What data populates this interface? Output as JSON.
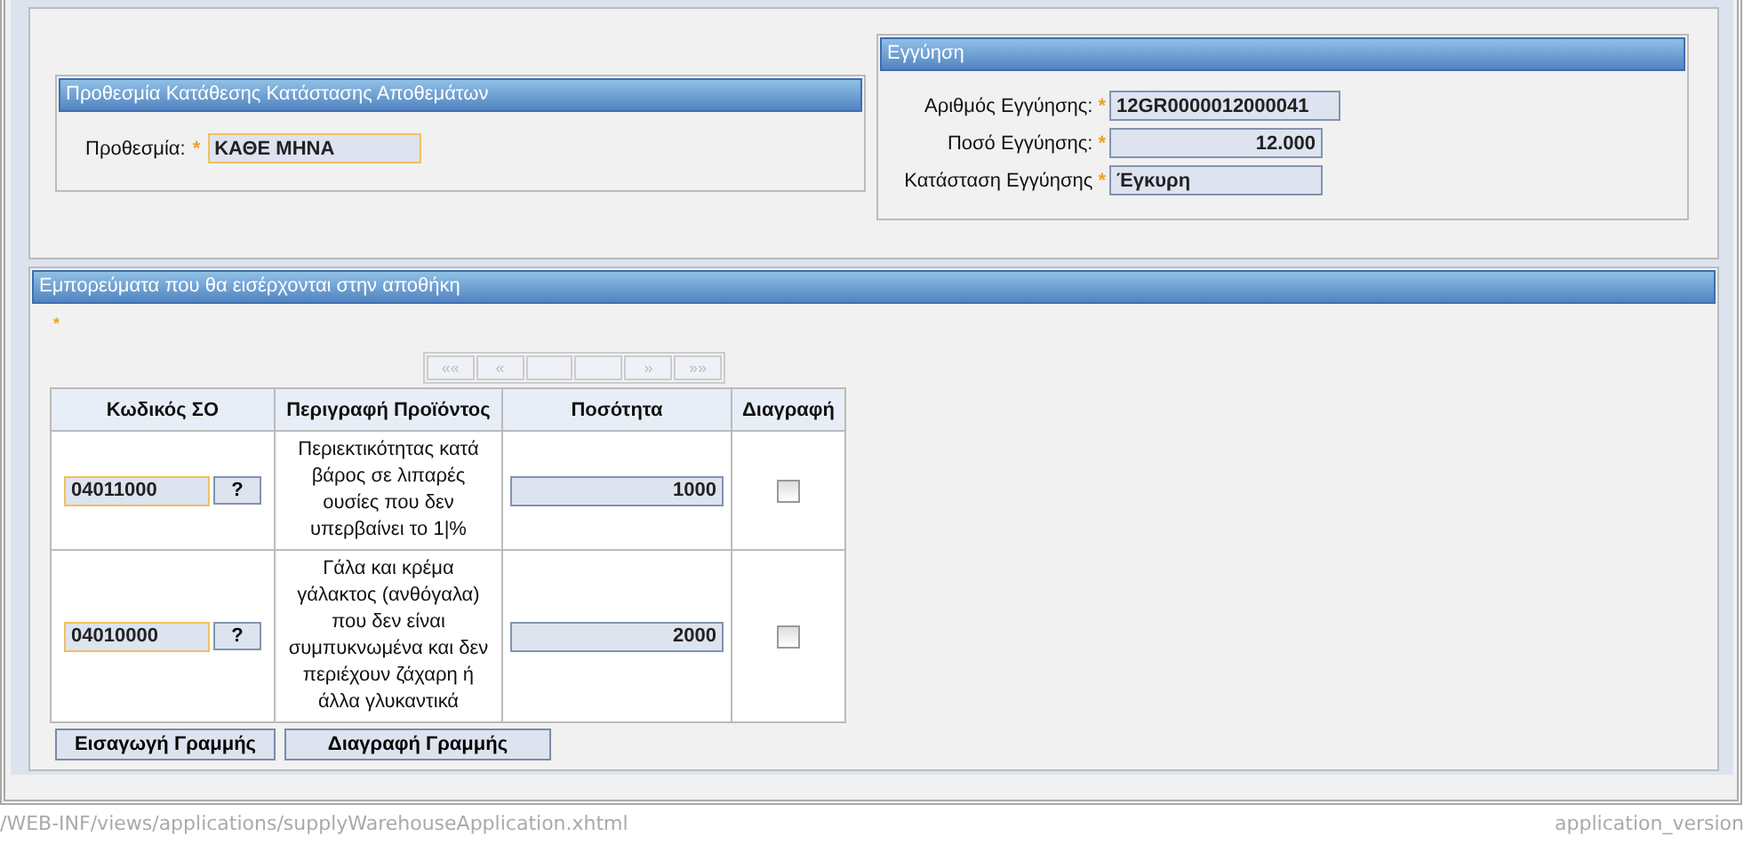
{
  "deadline_section": {
    "title": "Προθεσμία Κατάθεσης Κατάστασης Αποθεμάτων",
    "fields": [
      {
        "label": "Προθεσμία:",
        "mark": "*",
        "value": "ΚΑΘΕ ΜΗΝΑ",
        "highlighted": true
      }
    ]
  },
  "guarantee_section": {
    "title": "Εγγύηση",
    "fields": [
      {
        "label": "Αριθμός Εγγύησης:",
        "mark": "*",
        "value": "12GR0000012000041",
        "highlighted": false,
        "kind": "text"
      },
      {
        "label": "Ποσό Εγγύησης:",
        "mark": "*",
        "value": "12.000",
        "highlighted": false,
        "kind": "amount"
      },
      {
        "label": "Κατάσταση Εγγύησης",
        "mark": "*",
        "value": "Έγκυρη",
        "highlighted": false,
        "kind": "text"
      }
    ]
  },
  "goods_section": {
    "title": "Εμπορεύματα που θα εισέρχονται στην αποθήκη",
    "note_mark": "*",
    "paginator": [
      {
        "label": "««",
        "disabled": true
      },
      {
        "label": "«",
        "disabled": true
      },
      {
        "disabled": true
      },
      {
        "disabled": true
      },
      {
        "label": "»",
        "disabled": true
      },
      {
        "label": "»»",
        "disabled": true
      }
    ],
    "table": {
      "columns": [
        "Κωδικός ΣΟ",
        "Περιγραφή Προϊόντος",
        "Ποσότητα",
        "Διαγραφή"
      ],
      "rows": [
        {
          "code": "04011000",
          "code_highlighted": true,
          "lookup": "?",
          "description": "Περιεκτικότητας κατά βάρος σε λιπαρές ουσίες που δεν υπερβαίνει το 1|%",
          "quantity": "1000",
          "checked": false
        },
        {
          "code": "04010000",
          "code_highlighted": true,
          "lookup": "?",
          "description": "Γάλα και κρέμα γάλακτος (ανθόγαλα) που δεν είναι συμπυκνωμένα και δεν περιέχουν ζάχαρη ή άλλα γλυκαντικά",
          "quantity": "2000",
          "checked": false
        }
      ]
    },
    "buttons": [
      "Εισαγωγή Γραμμής",
      "Διαγραφή Γραμμής"
    ]
  },
  "footer": {
    "path": "/WEB-INF/views/applications/supplyWarehouseApplication.xhtml",
    "version": "application_version"
  }
}
